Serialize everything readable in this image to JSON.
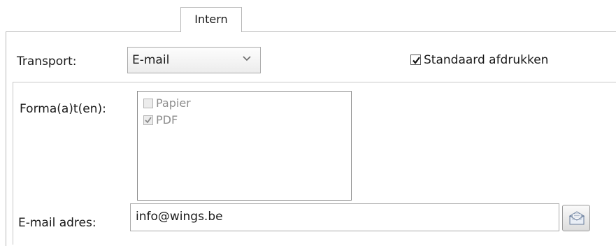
{
  "tabs": [
    {
      "label": "Intern",
      "active": true
    }
  ],
  "transport": {
    "label": "Transport:",
    "selected": "E-mail"
  },
  "print_default": {
    "label": "Standaard afdrukken",
    "checked": true
  },
  "formats": {
    "label": "Forma(a)t(en):",
    "items": [
      {
        "label": "Papier",
        "checked": false,
        "enabled": false
      },
      {
        "label": "PDF",
        "checked": true,
        "enabled": false
      }
    ]
  },
  "email": {
    "label": "E-mail adres:",
    "value": "info@wings.be",
    "button_icon": "mail-envelope-icon"
  }
}
